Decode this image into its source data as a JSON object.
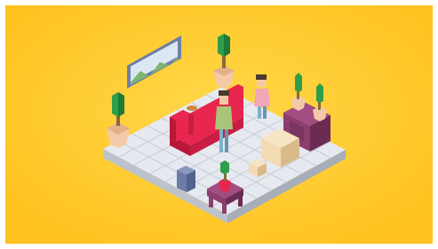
{
  "scene": {
    "description_elements": [
      "isometric-room",
      "tiled-floor",
      "framed-landscape-picture",
      "red-sofa",
      "two-people-standing",
      "wooden-cardboard-boxes",
      "potted-plants",
      "purple-cabinet-with-plants",
      "small-blue-stool",
      "small-purple-side-table"
    ]
  },
  "colors": {
    "background": "#FFC628",
    "background_glow": "#FFD84A",
    "floor_top": "#E6E9EF",
    "floor_side_left": "#BDC2CC",
    "floor_side_right": "#A7ADB9",
    "tile_line": "#C9CDD6",
    "sofa": "#E8264E",
    "sofa_dark": "#B9173A",
    "cabinet": "#8C3E6F",
    "cabinet_dark": "#6A2C53",
    "box": "#F2DAB3",
    "box_dark": "#D9BB8B",
    "pot": "#F4C9A8",
    "plant": "#2F9E4B",
    "plant_dark": "#1F7A36",
    "frame": "#6E7FA6",
    "picture_sky": "#DCE7F4",
    "picture_hills": "#7CB56F",
    "stool": "#6C7CA8",
    "person_shirt_green": "#A8C57A",
    "person_shirt_pink": "#F3A6B7",
    "person_pants": "#7BB0C9",
    "skin": "#F5C9A6",
    "hair": "#4A3A2E"
  }
}
